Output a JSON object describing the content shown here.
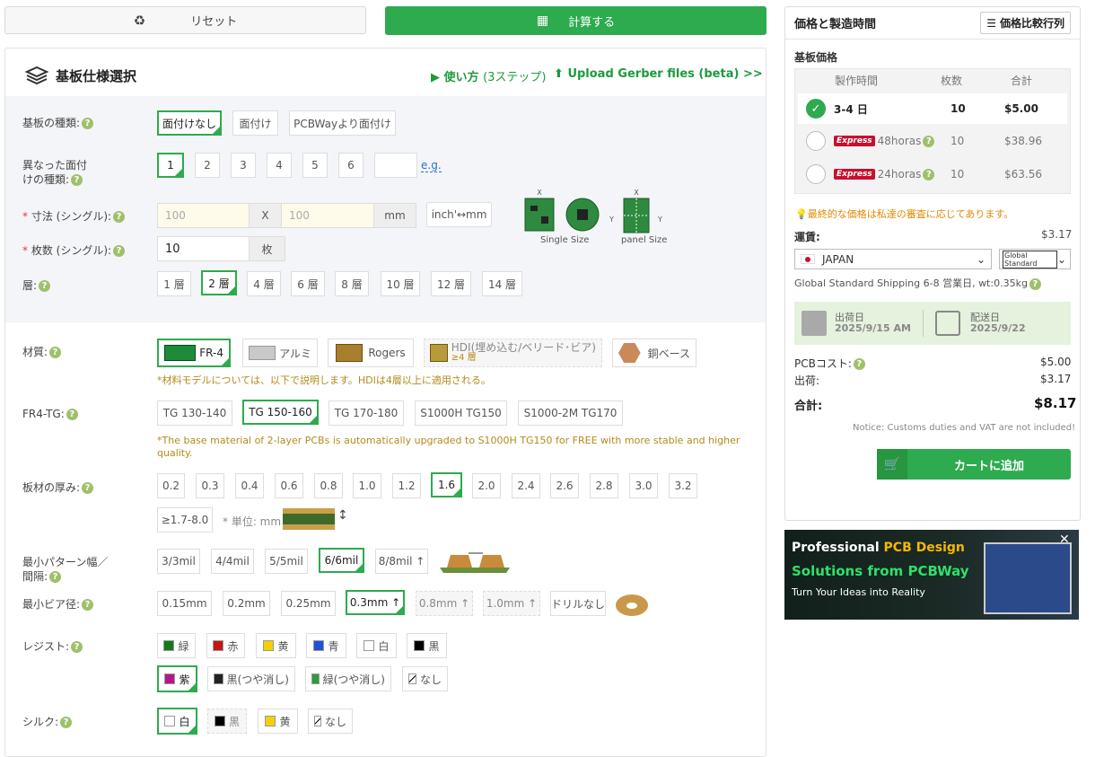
{
  "toolbar": {
    "reset_label": "リセット",
    "calc_label": "計算する"
  },
  "spec": {
    "title": "基板仕様選択",
    "howto_label": "使い方",
    "howto_steps": "(3ステップ)",
    "upload_label": "Upload Gerber files (beta) >>",
    "board_type": {
      "label": "基板の種類:",
      "options": [
        "面付けなし",
        "面付け",
        "PCBWayより面付け"
      ]
    },
    "diff_designs": {
      "label1": "異なった面付",
      "label2": "けの種類:",
      "options": [
        "1",
        "2",
        "3",
        "4",
        "5",
        "6"
      ],
      "eg": "e.g."
    },
    "size": {
      "label": "寸法 (シングル):",
      "w_placeholder": "100",
      "x": "X",
      "h_placeholder": "100",
      "unit": "mm",
      "convert": "inch'↔mm",
      "single_caption": "Single Size",
      "panel_caption": "panel Size",
      "x_mark": "X",
      "y_mark": "Y"
    },
    "qty": {
      "label": "枚数 (シングル):",
      "value": "10",
      "unit": "枚"
    },
    "layers": {
      "label": "層:",
      "options": [
        "1 層",
        "2 層",
        "4 層",
        "6 層",
        "8 層",
        "10 層",
        "12 層",
        "14 層"
      ]
    },
    "material": {
      "label": "材質:",
      "options": [
        "FR-4",
        "アルミ",
        "Rogers",
        "HDI(埋め込む/ベリード･ビア)",
        "銅ベース"
      ],
      "hdi_sub": "≥4 層",
      "note": "*材料モデルについては、以下で説明します。HDIは4層以上に適用される。"
    },
    "tg": {
      "label": "FR4-TG:",
      "options": [
        "TG 130-140",
        "TG 150-160",
        "TG 170-180",
        "S1000H TG150",
        "S1000-2M TG170"
      ],
      "note": "*The base material of 2-layer PCBs is automatically upgraded to S1000H TG150 for FREE with more stable and higher quality."
    },
    "thickness": {
      "label": "板材の厚み:",
      "options": [
        "0.2",
        "0.3",
        "0.4",
        "0.6",
        "0.8",
        "1.0",
        "1.2",
        "1.6",
        "2.0",
        "2.4",
        "2.6",
        "2.8",
        "3.0",
        "3.2",
        "≥1.7-8.0"
      ],
      "unit": "* 単位: mm"
    },
    "trace": {
      "label1": "最小パターン幅／",
      "label2": "間隔:",
      "options": [
        "3/3mil",
        "4/4mil",
        "5/5mil",
        "6/6mil",
        "8/8mil ↑"
      ]
    },
    "via": {
      "label": "最小ビア径:",
      "options": [
        "0.15mm",
        "0.2mm",
        "0.25mm",
        "0.3mm ↑",
        "0.8mm ↑",
        "1.0mm ↑",
        "ドリルなし"
      ]
    },
    "resist": {
      "label": "レジスト:",
      "options": [
        "緑",
        "赤",
        "黄",
        "青",
        "白",
        "黒",
        "紫",
        "黒(つや消し)",
        "緑(つや消し)",
        "なし"
      ]
    },
    "silk": {
      "label": "シルク:",
      "options": [
        "白",
        "黒",
        "黄",
        "なし"
      ]
    }
  },
  "colors": {
    "green": "#2eaa4f",
    "red": "#c8102e",
    "gold": "#b58a1c"
  },
  "price": {
    "title": "価格と製造時間",
    "compare_label": "価格比較行列",
    "base_label": "基板価格",
    "headers": [
      "製作時間",
      "枚数",
      "合計"
    ],
    "rows": [
      {
        "time": "3-4 日",
        "qty": "10",
        "total": "$5.00"
      },
      {
        "badge": "Express",
        "time": "48horas",
        "qty": "10",
        "total": "$38.96"
      },
      {
        "badge": "Express",
        "time": "24horas",
        "qty": "10",
        "total": "$63.56"
      }
    ],
    "review_note": "最終的な価格は私達の審査に応じてあります。",
    "shipping_label": "運賃:",
    "shipping_cost": "$3.17",
    "country": "JAPAN",
    "carrier": "Global Standard",
    "shipping_detail": "Global Standard Shipping   6-8 営業日, wt:0.35kg",
    "ship_date_label": "出荷日",
    "ship_date": "2025/9/15 AM",
    "delivery_label": "配送日",
    "delivery_date": "2025/9/22",
    "pcb_cost_label": "PCBコスト:",
    "pcb_cost": "$5.00",
    "ship_label": "出荷:",
    "ship_cost": "$3.17",
    "total_label": "合計:",
    "total": "$8.17",
    "customs_note": "Notice: Customs duties and VAT are not included!",
    "cart_label": "カートに追加"
  },
  "ad": {
    "line1a": "Professional ",
    "line1b": "PCB Design",
    "line2": "Solutions from PCBWay",
    "line3": "Turn Your Ideas into Reality"
  }
}
